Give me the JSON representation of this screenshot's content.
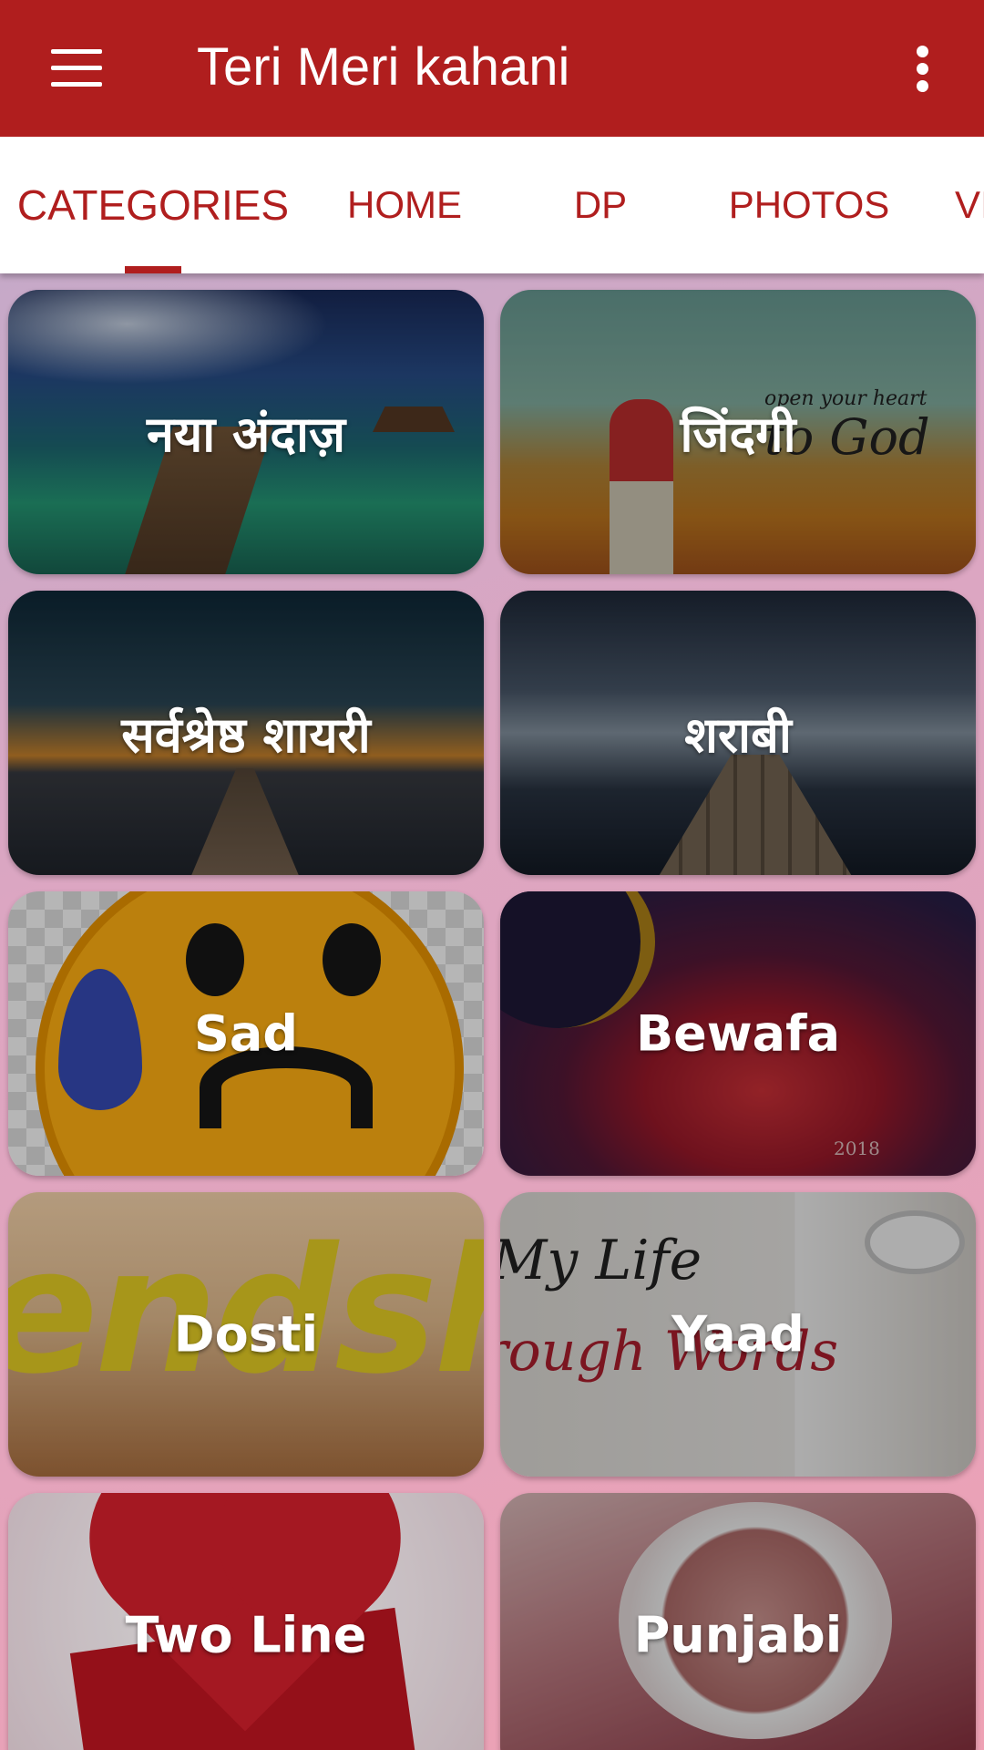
{
  "app": {
    "title": "Teri Meri kahani",
    "colors": {
      "primary": "#b01e1e",
      "tab_background": "#ffffff",
      "label_text": "#ffffff"
    }
  },
  "toolbar": {
    "menu_icon": "hamburger-menu-icon",
    "overflow_icon": "more-vertical-icon"
  },
  "tabs": [
    {
      "label": "CATEGORIES",
      "active": true
    },
    {
      "label": "HOME",
      "active": false
    },
    {
      "label": "DP",
      "active": false
    },
    {
      "label": "PHOTOS",
      "active": false
    },
    {
      "label": "VI",
      "active": false
    }
  ],
  "categories": [
    {
      "label": "नया अंदाज़"
    },
    {
      "label": "जिंदगी",
      "image_text": {
        "line1": "open your heart",
        "line2": "to God"
      }
    },
    {
      "label": "सर्वश्रेष्ठ शायरी"
    },
    {
      "label": "शराबी"
    },
    {
      "label": "Sad"
    },
    {
      "label": "Bewafa",
      "image_text": {
        "year": "2018"
      }
    },
    {
      "label": "Dosti",
      "image_text": {
        "word": "endsh"
      }
    },
    {
      "label": "Yaad",
      "image_text": {
        "line1": "My Life",
        "line2": "rough Words"
      }
    },
    {
      "label": "Two Line"
    },
    {
      "label": "Punjabi"
    }
  ]
}
